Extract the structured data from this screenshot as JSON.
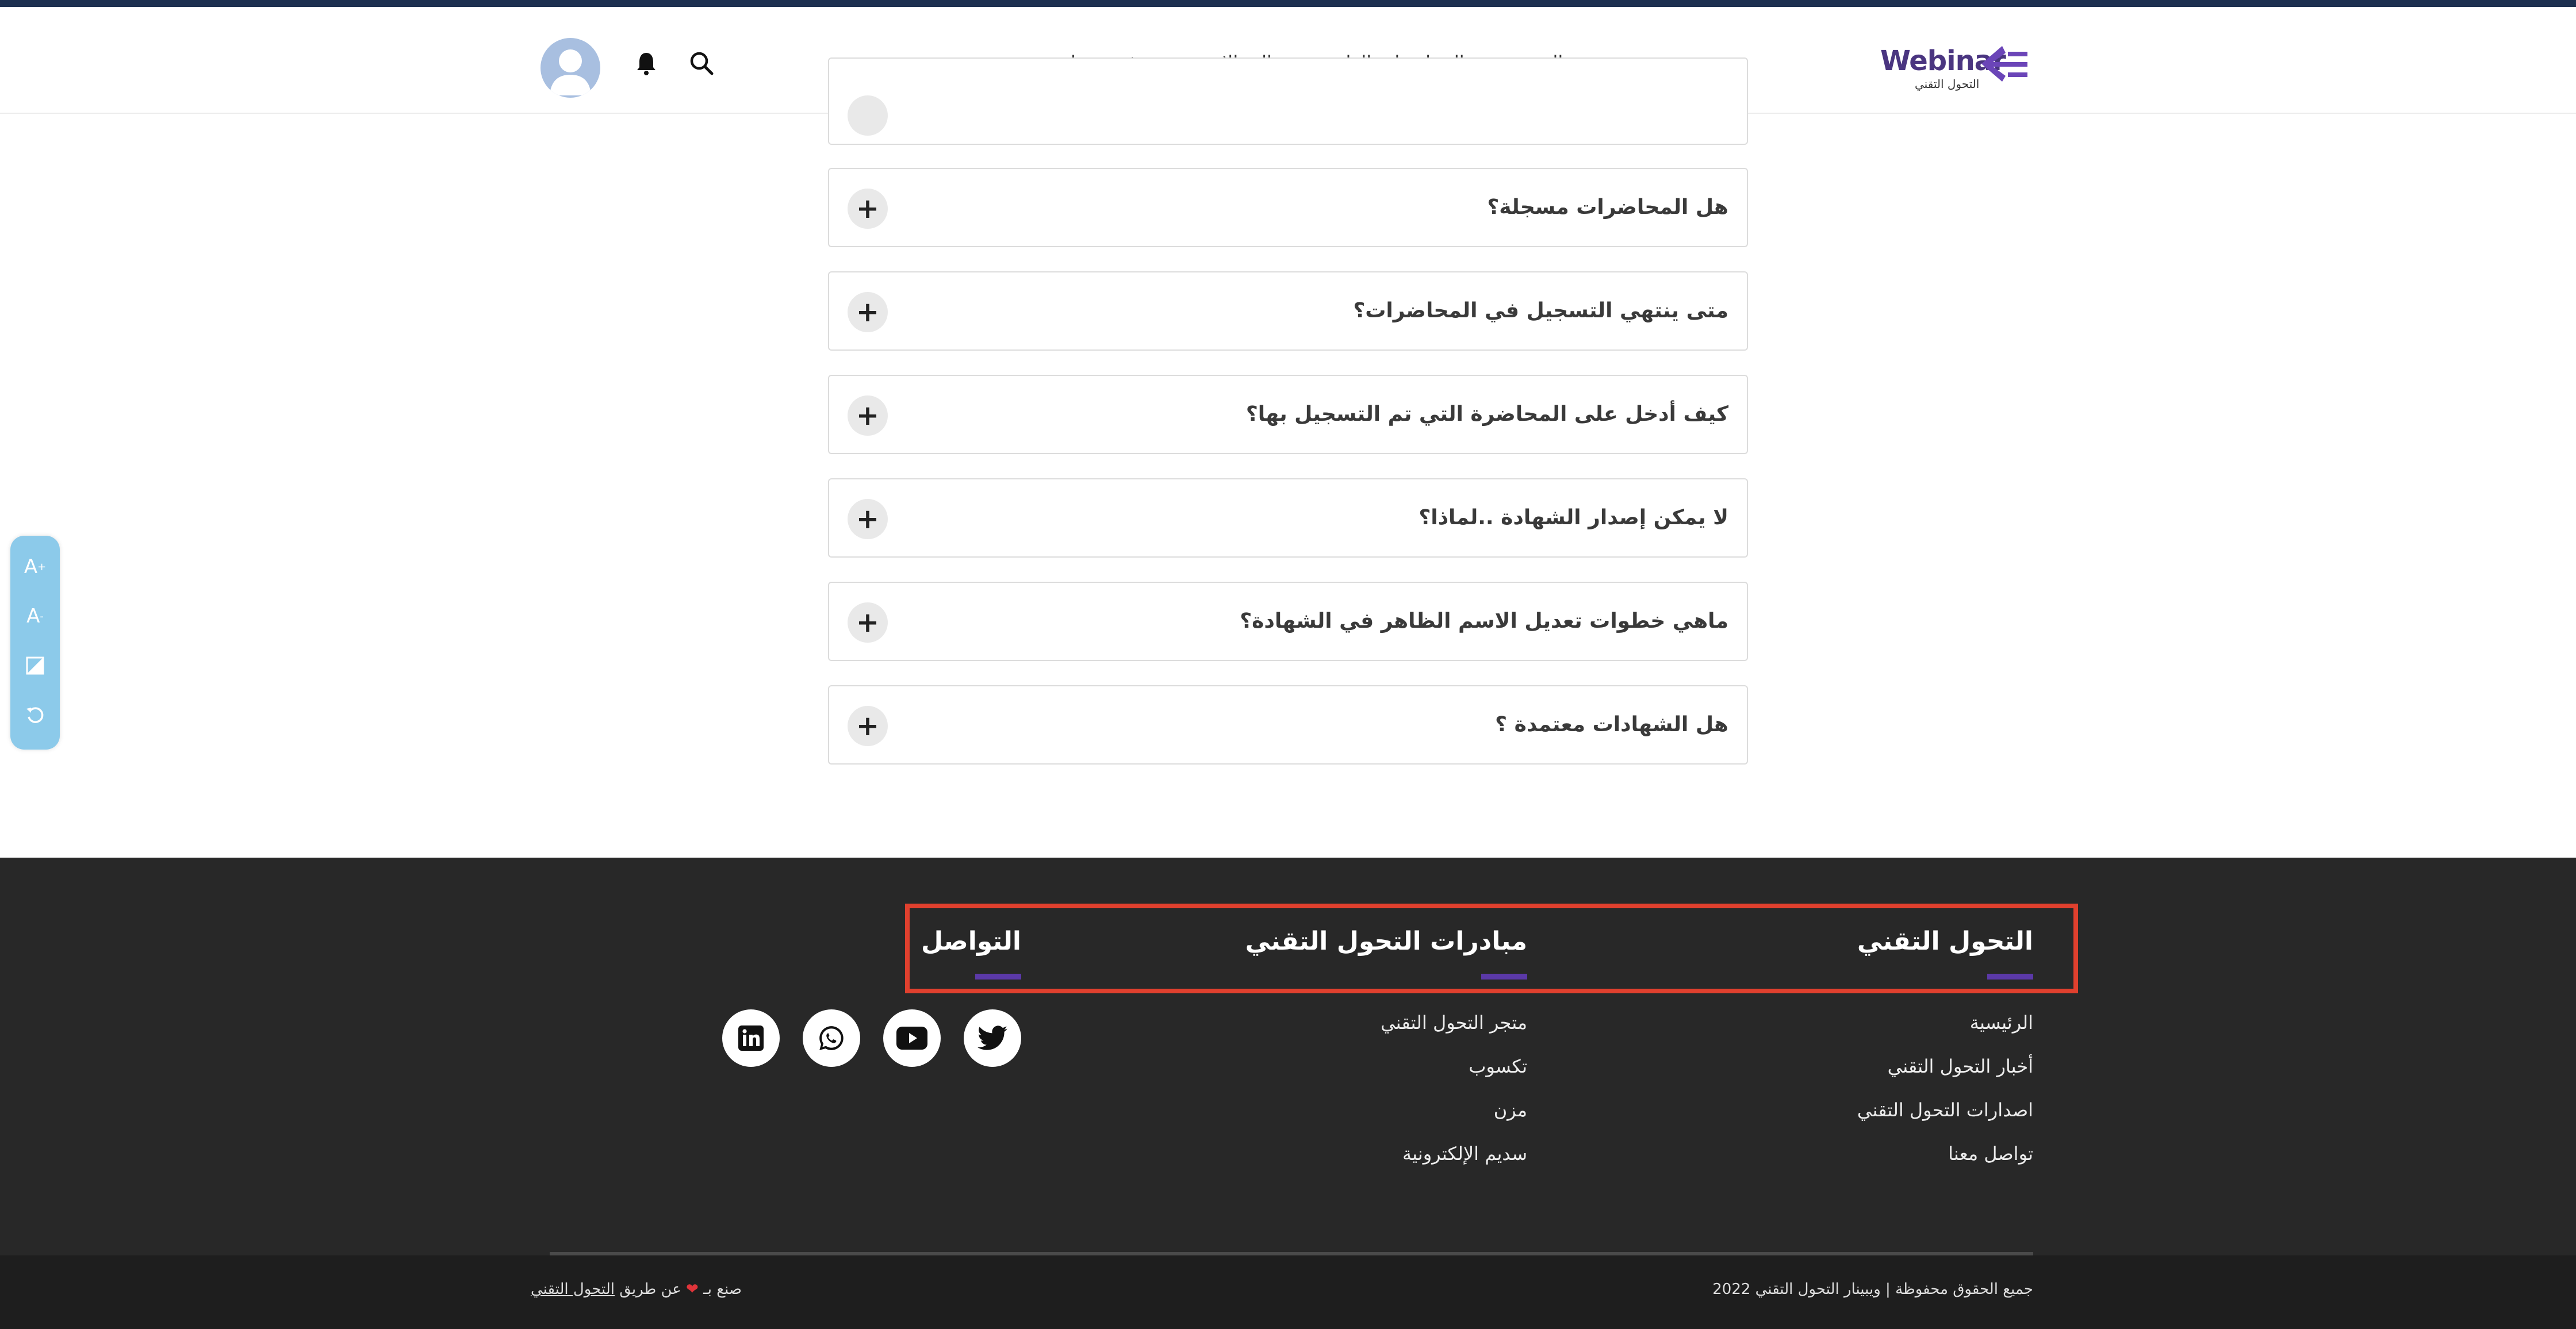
{
  "header": {
    "logo_text": "Webinar",
    "logo_sub": "التحول التقني",
    "nav": {
      "home": "الرئيسية",
      "upcoming": "المحاضرات القادمة",
      "fields": "المجالات",
      "train": "درّب معنا"
    }
  },
  "a11y": {
    "increase": "A",
    "decrease": "A"
  },
  "faq": {
    "items": [
      {
        "question": "هل المحاضرات مسجلة؟",
        "toggle": "+"
      },
      {
        "question": "متى ينتهي التسجيل في المحاضرات؟",
        "toggle": "+"
      },
      {
        "question": "كيف أدخل على المحاضرة التي تم التسجيل بها؟",
        "toggle": "+"
      },
      {
        "question": "لا يمكن إصدار الشهادة ..لماذا؟",
        "toggle": "+"
      },
      {
        "question": "ماهي خطوات تعديل الاسم الظاهر في الشهادة؟",
        "toggle": "+"
      },
      {
        "question": "هل الشهادات معتمدة ؟",
        "toggle": "+"
      }
    ]
  },
  "footer": {
    "col1": {
      "title": "التحول التقني",
      "links": [
        "الرئيسية",
        "أخبار التحول التقني",
        "اصدارات التحول التقني",
        "تواصل معنا"
      ]
    },
    "col2": {
      "title": "مبادرات التحول التقني",
      "links": [
        "متجر التحول التقني",
        "تكسوب",
        "مزن",
        "سديم الإلكترونية"
      ]
    },
    "col3": {
      "title": "التواصل"
    },
    "copyright": "جميع الحقوق محفوظة | ويبينار التحول التقني 2022",
    "made_prefix": "صنع بـ",
    "made_suffix": "عن طريق",
    "made_link": "التحول التقني"
  },
  "colors": {
    "brand": "#4a3580",
    "accent_bar": "#5b39a8",
    "highlight": "#e0402e",
    "footer_bg": "#282828"
  }
}
